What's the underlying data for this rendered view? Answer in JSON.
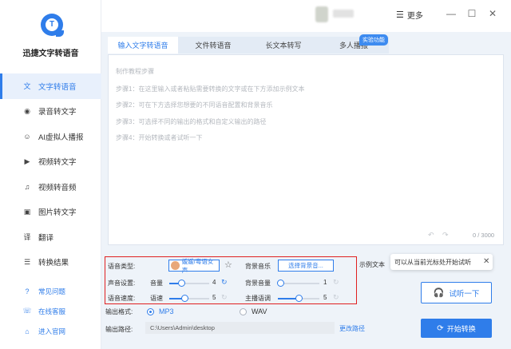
{
  "app": {
    "name": "迅捷文字转语音",
    "logo_letter": "T"
  },
  "sidebar": {
    "items": [
      {
        "label": "文字转语音",
        "icon": "text-to-speech-icon",
        "glyph": "文"
      },
      {
        "label": "录音转文字",
        "icon": "record-icon",
        "glyph": "◉"
      },
      {
        "label": "AI虚拟人播报",
        "icon": "ai-avatar-icon",
        "glyph": "☺"
      },
      {
        "label": "视频转文字",
        "icon": "video-icon",
        "glyph": "▶"
      },
      {
        "label": "视频转音频",
        "icon": "video-audio-icon",
        "glyph": "♫"
      },
      {
        "label": "图片转文字",
        "icon": "image-icon",
        "glyph": "▣"
      },
      {
        "label": "翻译",
        "icon": "translate-icon",
        "glyph": "译"
      },
      {
        "label": "转换结果",
        "icon": "results-icon",
        "glyph": "☰"
      }
    ],
    "help": [
      {
        "label": "常见问题",
        "icon": "question-icon",
        "glyph": "?"
      },
      {
        "label": "在线客服",
        "icon": "customer-service-icon",
        "glyph": "☏"
      },
      {
        "label": "进入官网",
        "icon": "website-icon",
        "glyph": "⌂"
      }
    ]
  },
  "topbar": {
    "more_label": "更多",
    "more_glyph": "☰",
    "minimize_glyph": "—",
    "maximize_glyph": "☐",
    "close_glyph": "✕"
  },
  "tabs": [
    {
      "label": "输入文字转语音",
      "active": true
    },
    {
      "label": "文件转语音",
      "active": false
    },
    {
      "label": "长文本转写",
      "active": false
    },
    {
      "label": "多人播报",
      "active": false
    }
  ],
  "lab_badge": "实验功能",
  "editor": {
    "hints": [
      "制作教程步骤",
      "步骤1：在这里输入或者粘贴需要转换的文字或在下方添加示例文本",
      "步骤2：可在下方选择您想要的不同语音配置和背景音乐",
      "步骤3：可选择不同的输出的格式和自定义输出的路径",
      "步骤4：开始转换或者试听一下"
    ],
    "undo_glyph": "↶",
    "redo_glyph": "↷",
    "count": "0 / 3000"
  },
  "settings": {
    "voice_type_label": "语音类型:",
    "voice_name": "媛媛/粤语女声",
    "star_glyph": "☆",
    "bgm_label": "背景音乐",
    "bgm_button": "选择背景音...",
    "sound_label": "声音设置:",
    "volume_label": "音量",
    "volume_value": "4",
    "bgm_volume_label": "背景音量",
    "bgm_volume_value": "1",
    "speed_label": "语音速度:",
    "speed_name": "语速",
    "speed_value": "5",
    "tone_label": "主播语调",
    "tone_value": "5",
    "reset_glyph": "↻"
  },
  "example_label": "示例文本",
  "tooltip": {
    "text": "可以从当前光标处开始试听",
    "close_glyph": "✕"
  },
  "listen_button": {
    "label": "试听一下",
    "glyph": "🎧"
  },
  "output": {
    "format_label": "输出格式:",
    "formats": [
      {
        "label": "MP3",
        "selected": true
      },
      {
        "label": "WAV",
        "selected": false
      }
    ],
    "path_label": "输出路径:",
    "path_value": "C:\\Users\\Admin\\desktop",
    "change_path": "更改路径"
  },
  "start_button": {
    "label": "开始转换",
    "glyph": "⟳"
  },
  "colors": {
    "accent": "#2f7dea",
    "highlight_border": "#e02020",
    "panel_bg": "#eef3f9"
  }
}
